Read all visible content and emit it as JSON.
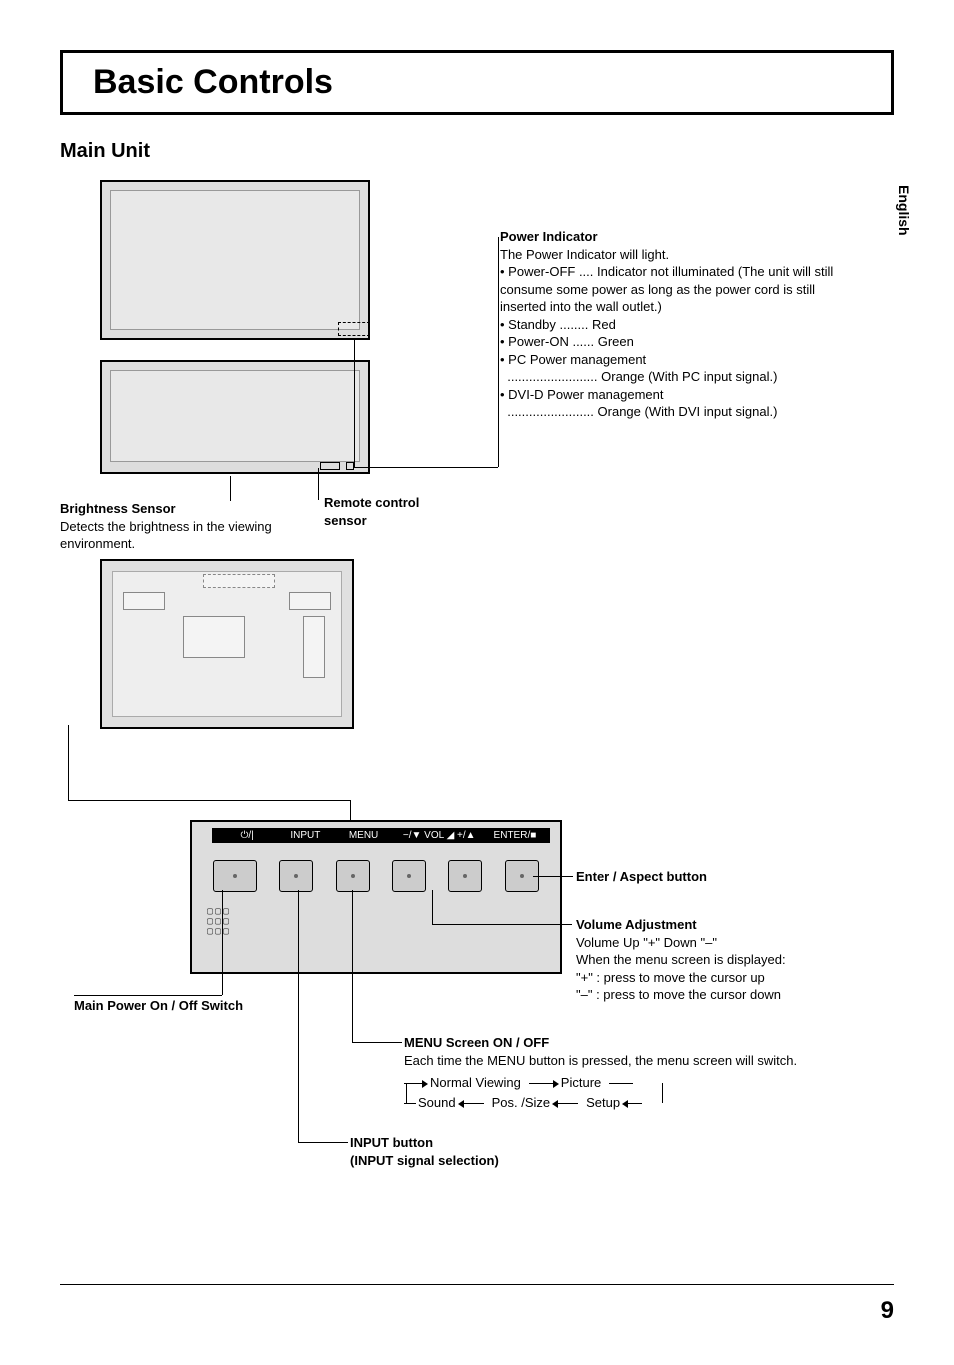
{
  "page": {
    "title": "Basic Controls",
    "section": "Main Unit",
    "language_tab": "English",
    "page_number": "9"
  },
  "labels": {
    "brightness_sensor": {
      "heading": "Brightness Sensor",
      "body": "Detects the brightness in the viewing environment."
    },
    "remote_sensor": {
      "heading": "Remote control sensor"
    },
    "power_indicator": {
      "heading": "Power Indicator",
      "intro": "The Power Indicator will light.",
      "items": [
        "• Power-OFF .... Indicator not illuminated (The unit will still consume some power as long as the power cord is still inserted into the wall outlet.)",
        "• Standby  ........ Red",
        "• Power-ON ...... Green",
        "• PC Power management",
        "  ......................... Orange (With PC input signal.)",
        "• DVI-D Power management",
        "  ........................ Orange (With DVI input signal.)"
      ]
    },
    "enter_aspect": {
      "heading": "Enter / Aspect button"
    },
    "volume": {
      "heading": "Volume Adjustment",
      "lines": [
        "Volume Up \"+\" Down \"–\"",
        "When the menu screen is displayed:",
        "\"+\" : press to move the cursor up",
        "\"–\" : press to move the cursor down"
      ]
    },
    "menu": {
      "heading": "MENU Screen ON / OFF",
      "body": "Each time the MENU button is pressed, the menu screen will switch.",
      "flow": [
        "Normal Viewing",
        "Picture",
        "Setup",
        "Pos. /Size",
        "Sound"
      ]
    },
    "input": {
      "heading": "INPUT button",
      "sub": "(INPUT signal selection)"
    },
    "main_power": {
      "heading": "Main Power On / Off Switch"
    },
    "panel_buttons": {
      "power_icon": "⏻/|",
      "input": "INPUT",
      "menu": "MENU",
      "vol": "−/▼ VOL ◢ +/▲",
      "enter": "ENTER/■"
    }
  }
}
